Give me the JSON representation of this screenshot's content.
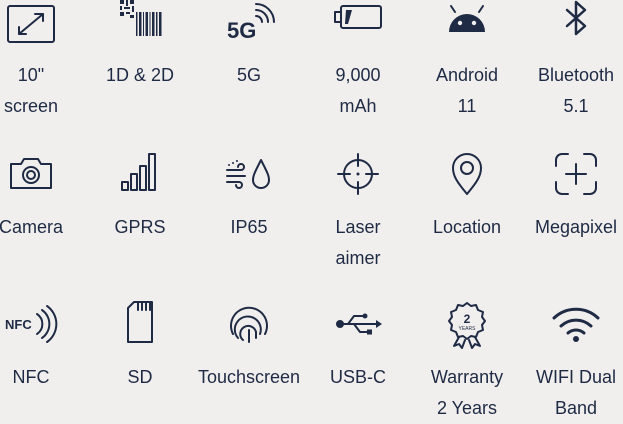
{
  "features": [
    {
      "icon": "tablet-screen-icon",
      "line1": "10\"",
      "line2": "screen"
    },
    {
      "icon": "qr-barcode-icon",
      "line1": "1D & 2D",
      "line2": ""
    },
    {
      "icon": "5g-signal-icon",
      "line1": "5G",
      "line2": "",
      "icon_text": "5G"
    },
    {
      "icon": "battery-icon",
      "line1": "9,000",
      "line2": "mAh"
    },
    {
      "icon": "android-icon",
      "line1": "Android",
      "line2": "11"
    },
    {
      "icon": "bluetooth-icon",
      "line1": "Bluetooth",
      "line2": "5.1"
    },
    {
      "icon": "camera-icon",
      "line1": "Camera",
      "line2": ""
    },
    {
      "icon": "signal-bars-icon",
      "line1": "GPRS",
      "line2": ""
    },
    {
      "icon": "dust-water-icon",
      "line1": "IP65",
      "line2": ""
    },
    {
      "icon": "crosshair-icon",
      "line1": "Laser",
      "line2": "aimer"
    },
    {
      "icon": "location-pin-icon",
      "line1": "Location",
      "line2": ""
    },
    {
      "icon": "focus-plus-icon",
      "line1": "Megapixel",
      "line2": ""
    },
    {
      "icon": "nfc-icon",
      "line1": "NFC",
      "line2": "",
      "icon_text": "NFC"
    },
    {
      "icon": "sd-card-icon",
      "line1": "SD",
      "line2": ""
    },
    {
      "icon": "fingerprint-icon",
      "line1": "Touchscreen",
      "line2": ""
    },
    {
      "icon": "usb-icon",
      "line1": "USB-C",
      "line2": ""
    },
    {
      "icon": "warranty-badge-icon",
      "line1": "Warranty",
      "line2": "2 Years",
      "icon_text": "2",
      "icon_subtext": "YEARS"
    },
    {
      "icon": "wifi-icon",
      "line1": "WIFI Dual",
      "line2": "Band"
    }
  ]
}
